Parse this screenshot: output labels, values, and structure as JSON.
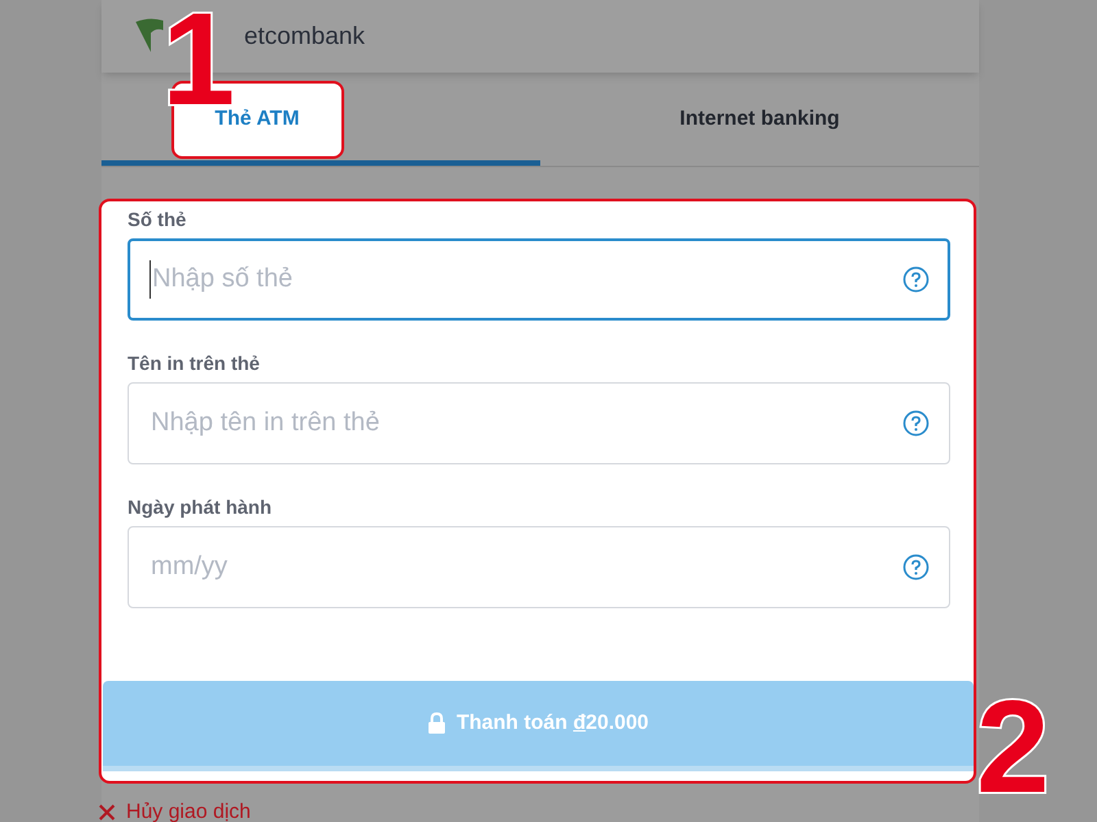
{
  "header": {
    "brand": "etcombank"
  },
  "tabs": [
    {
      "label": "Thẻ ATM",
      "selected": true
    },
    {
      "label": "Internet banking",
      "selected": false
    }
  ],
  "fields": [
    {
      "label": "Số thẻ",
      "placeholder": "Nhập số thẻ",
      "focused": true
    },
    {
      "label": "Tên in trên thẻ",
      "placeholder": "Nhập tên in trên thẻ",
      "focused": false
    },
    {
      "label": "Ngày phát hành",
      "placeholder": "mm/yy",
      "focused": false
    }
  ],
  "pay_button": {
    "label": "Thanh toán",
    "currency": "đ",
    "amount": "20.000"
  },
  "cancel_link": {
    "label": "Hủy giao dịch"
  },
  "annotations": [
    {
      "number": "1"
    },
    {
      "number": "2"
    }
  ]
}
